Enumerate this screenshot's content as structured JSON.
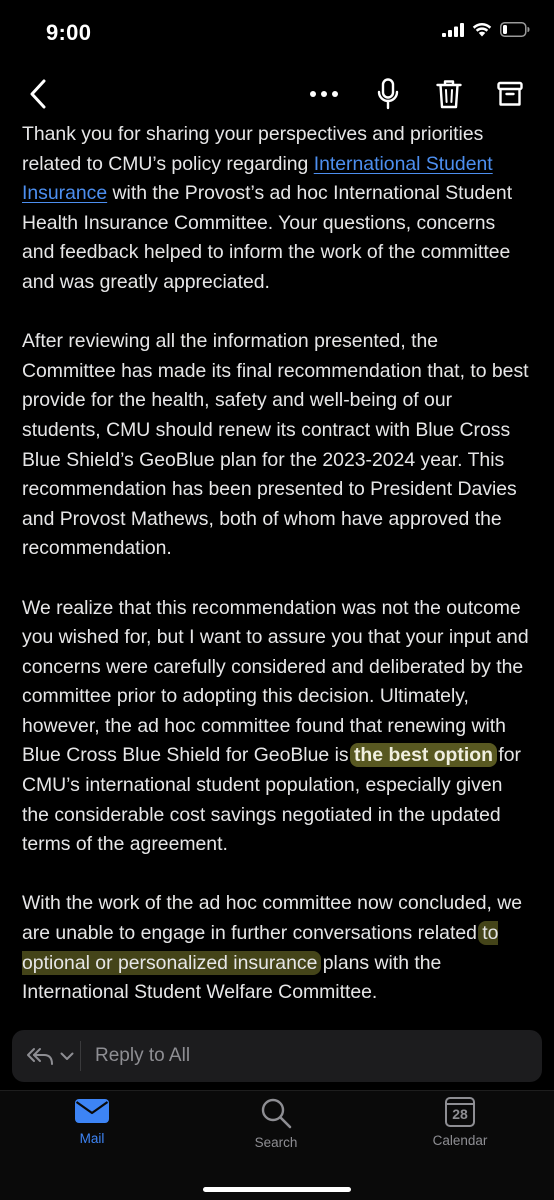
{
  "status": {
    "time": "9:00"
  },
  "email": {
    "paragraphs": [
      {
        "before": "Thank you for sharing your perspectives and priorities related to CMU’s policy regarding ",
        "link": "International Student Insurance",
        "after": " with the Provost’s ad hoc International Student Health Insurance Committee.  Your questions, concerns and feedback helped to inform the work of the committee and was greatly appreciated."
      },
      {
        "text": "After reviewing all the information presented, the Committee has made its final recommendation that, to best provide for the health, safety and well-being of our students, CMU should renew its contract with Blue Cross Blue Shield’s GeoBlue plan for the 2023-2024 year. This recommendation has been presented to President Davies and Provost Mathews, both of whom have approved the recommendation."
      },
      {
        "before": "We realize that this recommendation was not the outcome you wished for, but I want to assure you that your input and concerns were carefully considered and deliberated by the committee prior to adopting this decision.  Ultimately, however, the ad hoc committee found that renewing with Blue Cross Blue Shield for GeoBlue is ",
        "highlight": "the best option",
        "after": " for CMU’s international student population, especially given the considerable cost savings negotiated in the updated terms of the agreement."
      },
      {
        "before": "With the work of the ad hoc committee now concluded, we are unable to engage in further conversations related ",
        "highlight": "to optional or personalized insurance",
        "after": " plans with the International Student Welfare Committee."
      }
    ]
  },
  "reply": {
    "placeholder": "Reply to All"
  },
  "tabs": [
    {
      "label": "Mail",
      "active": true
    },
    {
      "label": "Search",
      "active": false
    },
    {
      "label": "Calendar",
      "active": false,
      "day": "28"
    }
  ],
  "colors": {
    "accent": "#3d84f5",
    "inactive": "#8e8e93",
    "highlight": "#8f8f3a"
  }
}
